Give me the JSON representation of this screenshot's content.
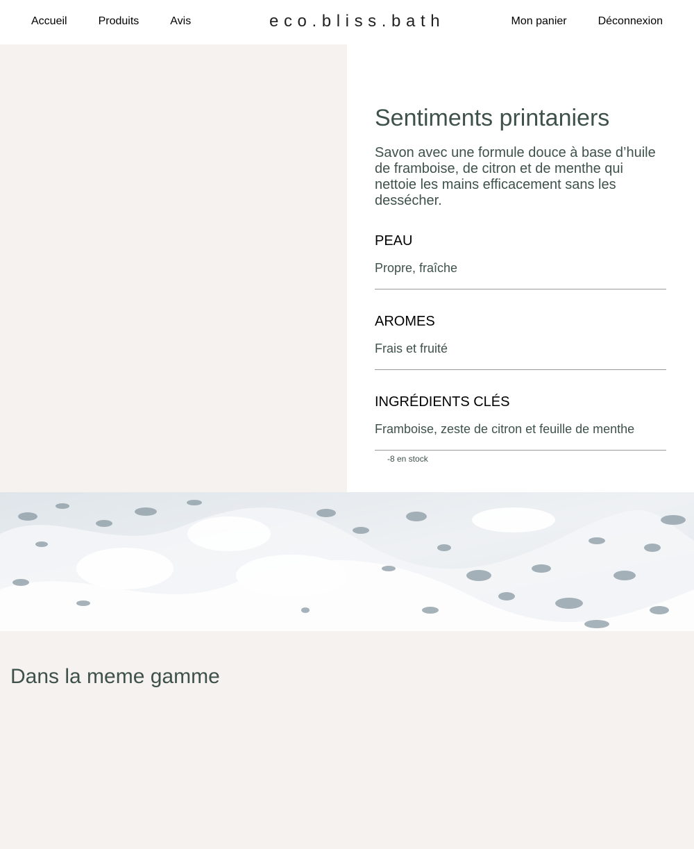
{
  "nav": {
    "left": [
      "Accueil",
      "Produits",
      "Avis"
    ],
    "logo": "eco.bliss.bath",
    "right": [
      "Mon panier",
      "Déconnexion"
    ]
  },
  "product": {
    "title": "Sentiments printaniers",
    "description": "Savon avec une formule douce à base d’huile de framboise, de citron et de menthe qui nettoie les mains efficacement sans les dessécher.",
    "details": [
      {
        "heading": "PEAU",
        "text": "Propre, fraîche"
      },
      {
        "heading": "AROMES",
        "text": "Frais et fruité"
      },
      {
        "heading": "INGRÉDIENTS CLÉS",
        "text": "Framboise, zeste de citron et feuille de menthe"
      }
    ],
    "stock": "-8 en stock"
  },
  "range": {
    "title": "Dans la meme gamme"
  },
  "colors": {
    "brand_green": "#3e514a",
    "page_background": "#f6f2ef",
    "divider": "#999999"
  }
}
